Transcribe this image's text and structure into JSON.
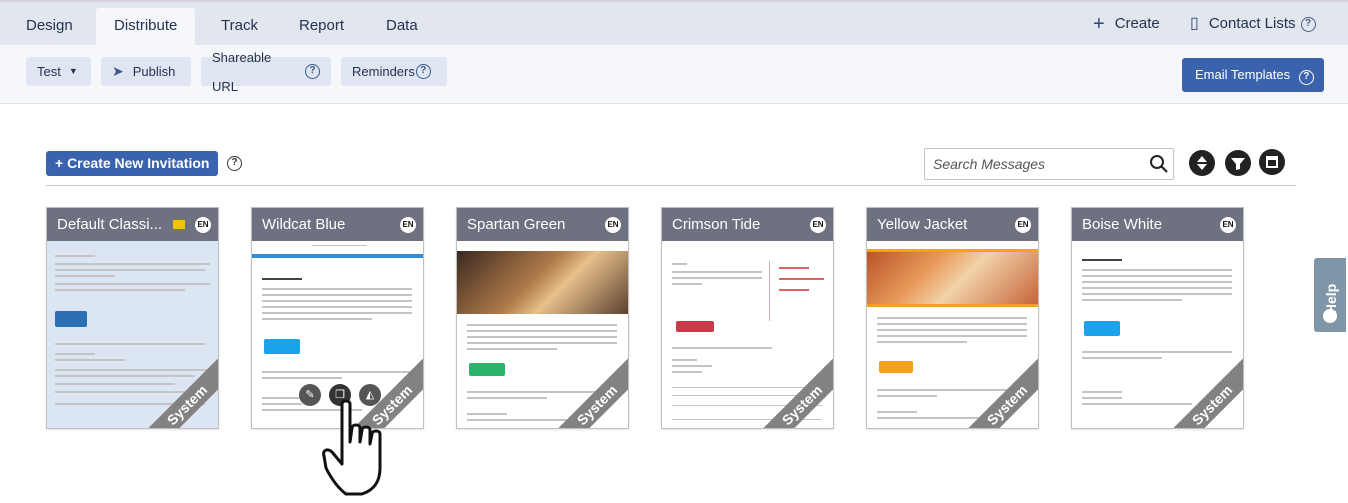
{
  "nav": {
    "tabs": [
      {
        "label": "Design"
      },
      {
        "label": "Distribute"
      },
      {
        "label": "Track"
      },
      {
        "label": "Report"
      },
      {
        "label": "Data"
      }
    ],
    "create_label": "Create",
    "contact_lists_label": "Contact Lists"
  },
  "toolbar": {
    "test_label": "Test",
    "publish_label": "Publish",
    "shareable_url_label": "Shareable URL",
    "reminders_label": "Reminders",
    "email_templates_label": "Email Templates"
  },
  "main": {
    "create_invitation_label": "+ Create New Invitation",
    "search_placeholder": "Search Messages"
  },
  "cards": [
    {
      "title": "Default Classi...",
      "lang": "EN",
      "badge": "System"
    },
    {
      "title": "Wildcat Blue",
      "lang": "EN",
      "badge": "System"
    },
    {
      "title": "Spartan Green",
      "lang": "EN",
      "badge": "System"
    },
    {
      "title": "Crimson Tide",
      "lang": "EN",
      "badge": "System"
    },
    {
      "title": "Yellow Jacket",
      "lang": "EN",
      "badge": "System"
    },
    {
      "title": "Boise White",
      "lang": "EN",
      "badge": "System"
    }
  ],
  "help_tab_label": "Help",
  "colors": {
    "accent": "#3b62ad",
    "nav_bg": "#e1e6ef",
    "card_head": "#6e7180"
  }
}
